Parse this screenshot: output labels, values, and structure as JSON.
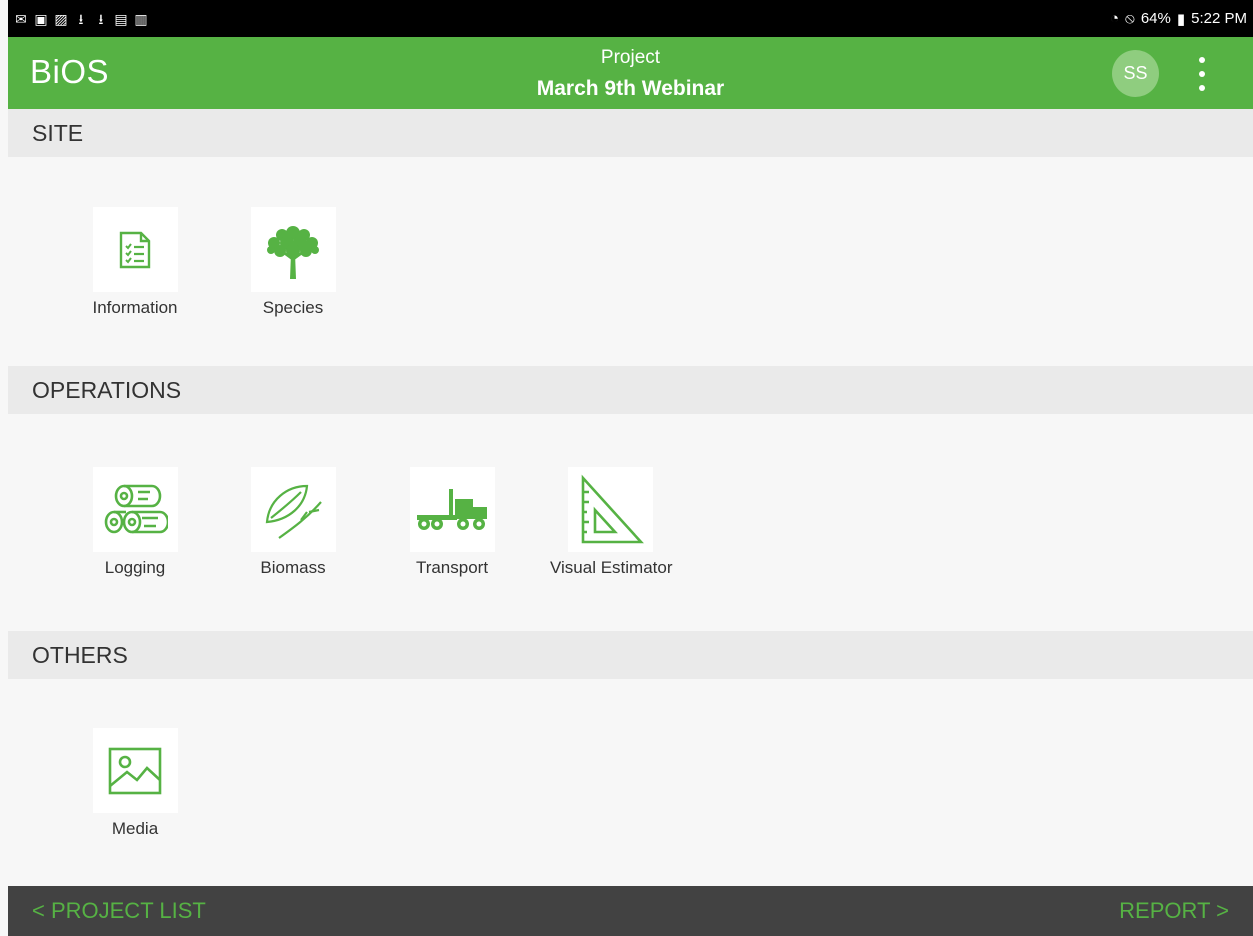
{
  "statusbar": {
    "left_icons": [
      "mail-icon",
      "bag-icon",
      "image-icon",
      "download-icon",
      "download-icon",
      "lock-icon",
      "image-off-icon"
    ],
    "battery": "64%",
    "time": "5:22 PM"
  },
  "appbar": {
    "brand": "BiOS",
    "project_label": "Project",
    "project_name": "March 9th Webinar",
    "avatar_initials": "SS"
  },
  "sections": {
    "site": {
      "title": "SITE",
      "items": [
        {
          "label": "Information",
          "icon": "checklist-icon"
        },
        {
          "label": "Species",
          "icon": "tree-icon"
        }
      ]
    },
    "operations": {
      "title": "OPERATIONS",
      "items": [
        {
          "label": "Logging",
          "icon": "logs-icon"
        },
        {
          "label": "Biomass",
          "icon": "leaf-icon"
        },
        {
          "label": "Transport",
          "icon": "truck-icon"
        },
        {
          "label": "Visual Estimator",
          "icon": "triangle-ruler-icon"
        }
      ]
    },
    "others": {
      "title": "OTHERS",
      "items": [
        {
          "label": "Media",
          "icon": "image-icon"
        }
      ]
    }
  },
  "footer": {
    "left": "< PROJECT LIST",
    "right": "REPORT >"
  },
  "colors": {
    "accent": "#56b244",
    "footer_bg": "#424242",
    "status_bg": "#000000"
  }
}
